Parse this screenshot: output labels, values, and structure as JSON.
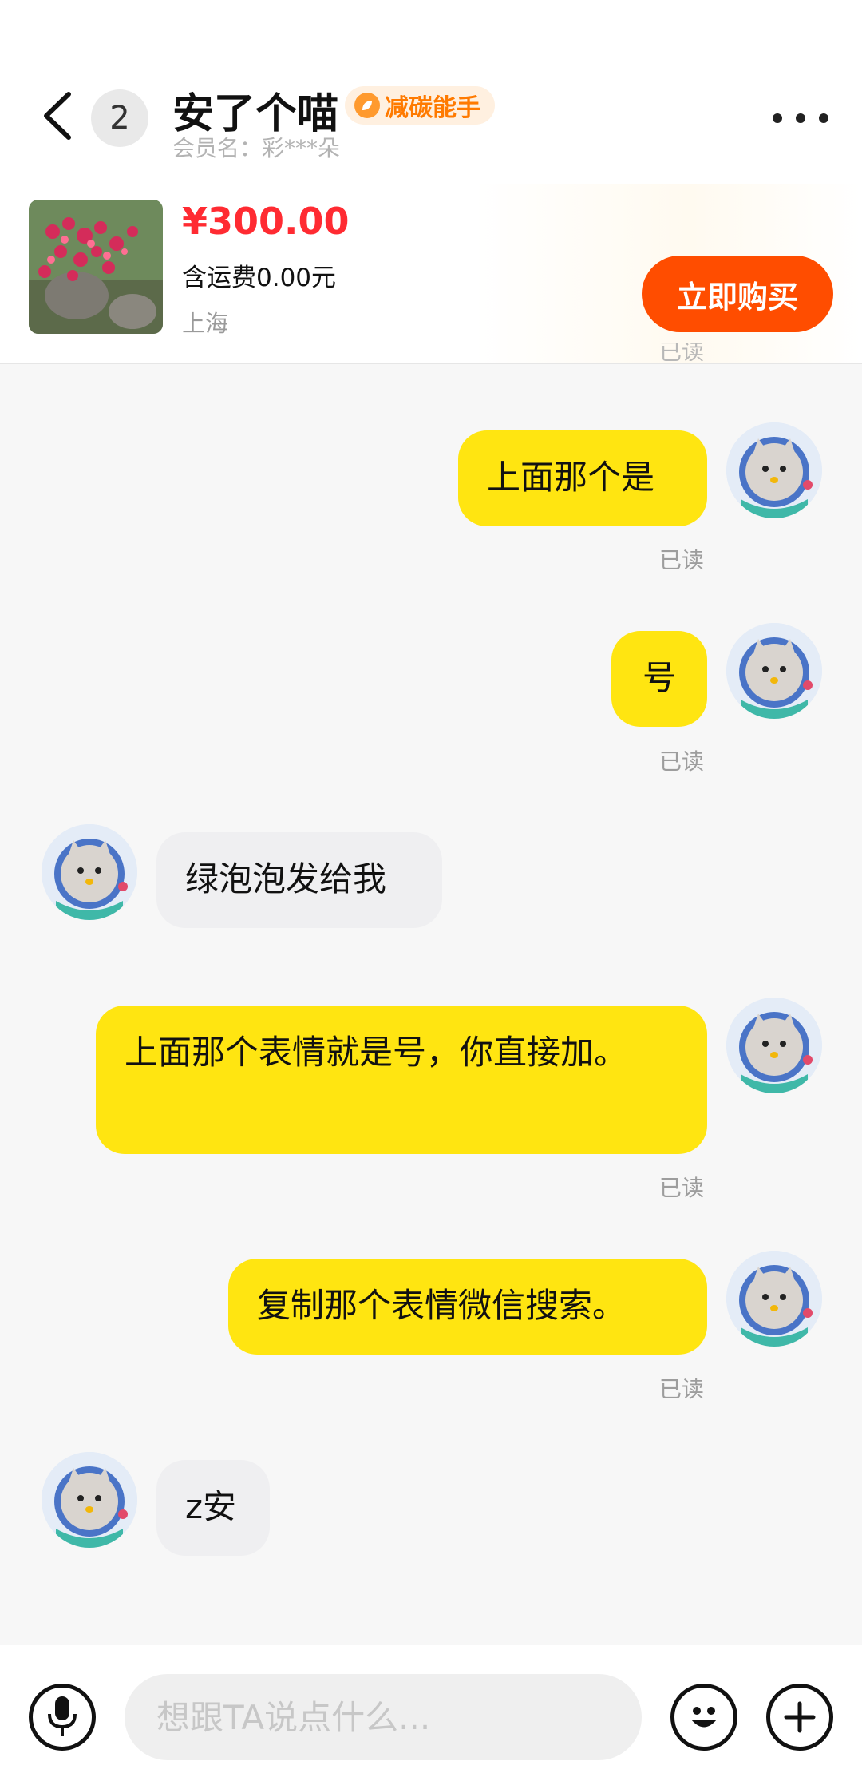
{
  "header": {
    "unread_count": "2",
    "seller_name": "安了个喵",
    "eco_badge": "减碳能手",
    "member_label": "会员名：彩***朵"
  },
  "product": {
    "price": "¥300.00",
    "shipping": "含运费0.00元",
    "location": "上海",
    "buy_label": "立即购买"
  },
  "messages": [
    {
      "from": "me",
      "text": "上面那个是",
      "status": "已读"
    },
    {
      "from": "me",
      "text": "号",
      "status": "已读"
    },
    {
      "from": "them",
      "text": "绿泡泡发给我"
    },
    {
      "from": "me",
      "text": "上面那个表情就是号，你直接加。",
      "status": "已读"
    },
    {
      "from": "me",
      "text": "复制那个表情微信搜索。",
      "status": "已读"
    },
    {
      "from": "them",
      "text": "z安"
    }
  ],
  "input": {
    "placeholder": "想跟TA说点什么..."
  },
  "peek_status": "已读",
  "icons": {
    "back": "chevron-left-icon",
    "more": "more-dots-icon",
    "mic": "microphone-icon",
    "emoji": "emoji-icon",
    "plus": "plus-icon"
  },
  "colors": {
    "price": "#ff2b32",
    "buy_button": "#ff4d00",
    "my_bubble": "#ffe511",
    "their_bubble": "#efeff1"
  }
}
